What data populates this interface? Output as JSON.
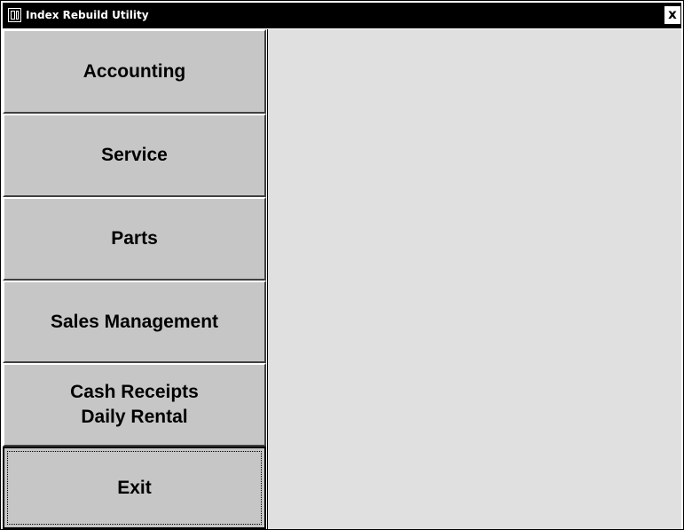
{
  "window": {
    "title": "Index Rebuild Utility",
    "close_glyph": "x"
  },
  "sidebar": {
    "items": [
      {
        "label": "Accounting"
      },
      {
        "label": "Service"
      },
      {
        "label": "Parts"
      },
      {
        "label": "Sales Management"
      },
      {
        "label": "Cash Receipts\nDaily Rental"
      },
      {
        "label": "Exit"
      }
    ]
  },
  "colors": {
    "titlebar": "#000000",
    "button_face": "#c6c6c6",
    "content_bg": "#e0e0e0"
  }
}
